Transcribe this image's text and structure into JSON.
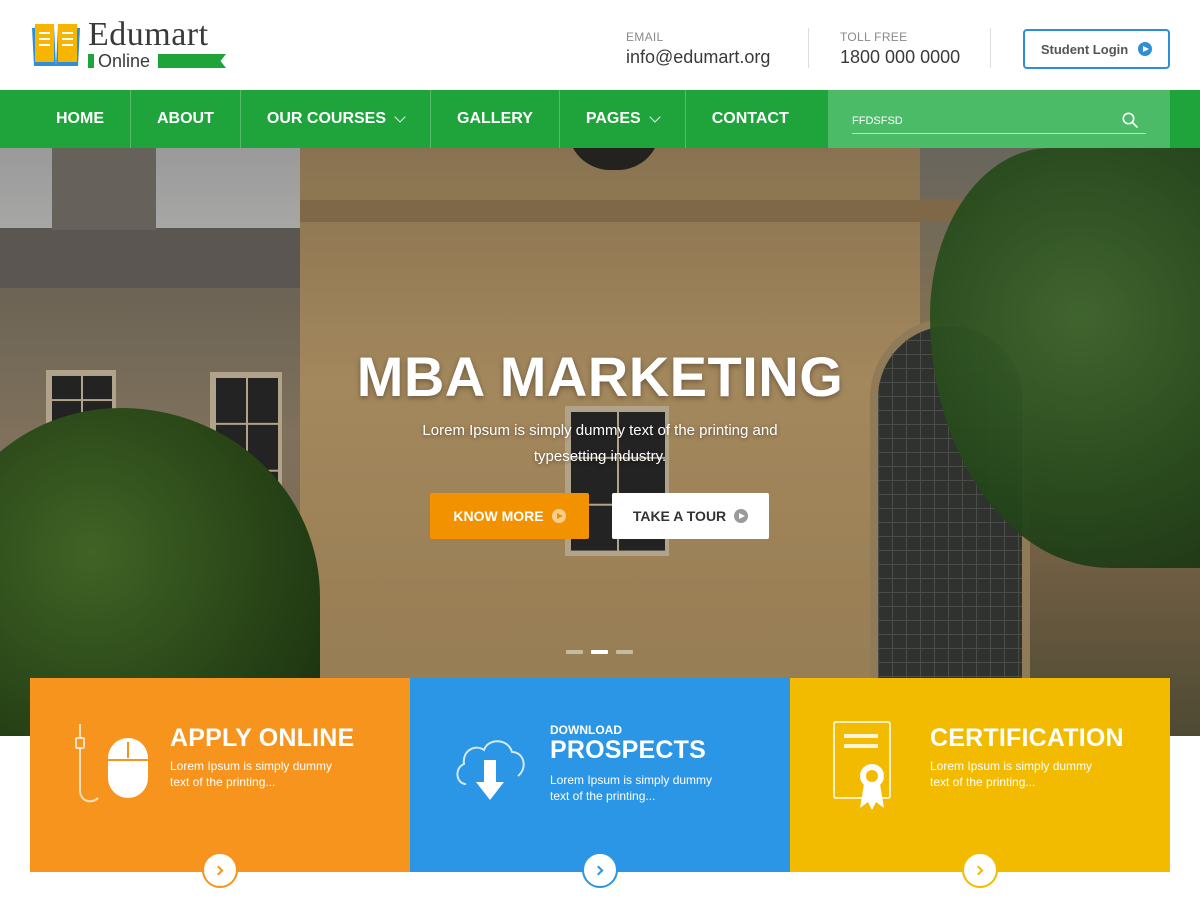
{
  "brand": {
    "name": "Edumart",
    "tagline": "Online",
    "accent": "#1fa43c"
  },
  "contact": {
    "email_label": "EMAIL",
    "email_value": "info@edumart.org",
    "phone_label": "TOLL FREE",
    "phone_value": "1800 000 0000"
  },
  "login": {
    "label": "Student Login",
    "icon": "play-circle-icon",
    "color": "#2e8fd8"
  },
  "nav": {
    "items": [
      {
        "label": "HOME",
        "dropdown": false
      },
      {
        "label": "ABOUT",
        "dropdown": false
      },
      {
        "label": "OUR COURSES",
        "dropdown": true
      },
      {
        "label": "GALLERY",
        "dropdown": false
      },
      {
        "label": "PAGES",
        "dropdown": true
      },
      {
        "label": "CONTACT",
        "dropdown": false
      }
    ],
    "search": {
      "value": "FFDSFSD",
      "placeholder": "FFDSFSD",
      "icon": "search-icon"
    }
  },
  "hero": {
    "title": "MBA MARKETING",
    "description": "Lorem Ipsum is simply dummy text of the printing and typesetting industry.",
    "primary_button": "KNOW MORE",
    "secondary_button": "TAKE A TOUR",
    "slides": 3,
    "active_slide": 2
  },
  "features": [
    {
      "kicker": "",
      "title": "APPLY ONLINE",
      "text": "Lorem Ipsum is simply dummy text of the printing...",
      "icon": "mouse-icon",
      "color": "#f7941d"
    },
    {
      "kicker": "DOWNLOAD",
      "title": "PROSPECTS",
      "text": "Lorem Ipsum is simply dummy text of the printing...",
      "icon": "cloud-download-icon",
      "color": "#2b95e6"
    },
    {
      "kicker": "",
      "title": "CERTIFICATION",
      "text": "Lorem Ipsum is simply dummy text of the printing...",
      "icon": "certificate-icon",
      "color": "#f2bb00"
    }
  ]
}
